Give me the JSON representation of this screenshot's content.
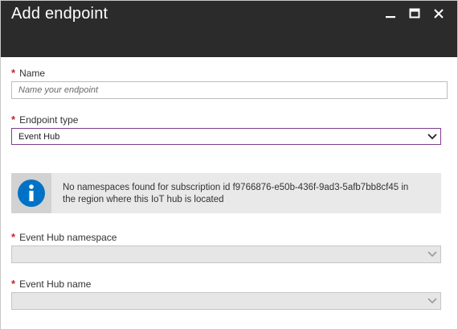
{
  "window": {
    "title": "Add endpoint",
    "controls": [
      "minimize-icon",
      "maximize-icon",
      "close-icon"
    ]
  },
  "form": {
    "required_marker": "*",
    "name": {
      "label": "Name",
      "value": "",
      "placeholder": "Name your endpoint"
    },
    "endpoint_type": {
      "label": "Endpoint type",
      "selected": "Event Hub"
    },
    "info": {
      "icon": "info-icon",
      "line1": "No namespaces found for subscription id f9766876-e50b-436f-9ad3-5afb7bb8cf45 in",
      "line2": "the region where this IoT hub is located"
    },
    "event_hub_namespace": {
      "label": "Event Hub namespace",
      "selected": "",
      "disabled": true
    },
    "event_hub_name": {
      "label": "Event Hub name",
      "selected": "",
      "disabled": true
    }
  },
  "colors": {
    "titlebar": "#2b2b2b",
    "required": "#c4262e",
    "active_border": "#7c3e8c",
    "info_icon": "#0072c6"
  }
}
